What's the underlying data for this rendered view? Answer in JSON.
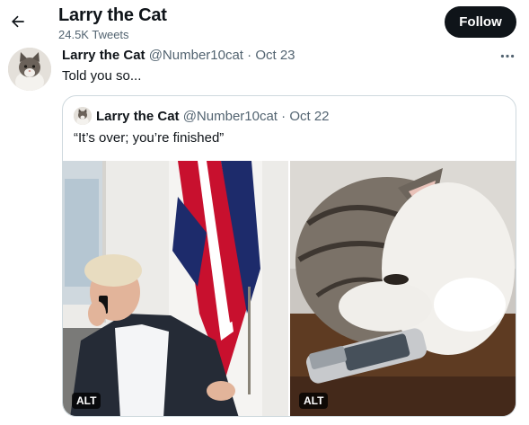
{
  "header": {
    "back_icon": "arrow-left-icon",
    "profile_name": "Larry the Cat",
    "tweet_count": "24.5K Tweets",
    "follow_label": "Follow"
  },
  "tweet": {
    "author_name": "Larry the Cat",
    "author_handle": "@Number10cat",
    "separator": "·",
    "date": "Oct 23",
    "text": "Told you so...",
    "more_icon": "more-horizontal-icon"
  },
  "quoted_tweet": {
    "author_name": "Larry the Cat",
    "author_handle": "@Number10cat",
    "separator": "·",
    "date": "Oct 22",
    "text": "“It’s over; you’re finished”",
    "media": [
      {
        "alt_label": "ALT"
      },
      {
        "alt_label": "ALT"
      }
    ]
  },
  "colors": {
    "text_primary": "#0f1419",
    "text_secondary": "#536471",
    "border": "#cfd9de",
    "follow_bg": "#0f1419"
  }
}
